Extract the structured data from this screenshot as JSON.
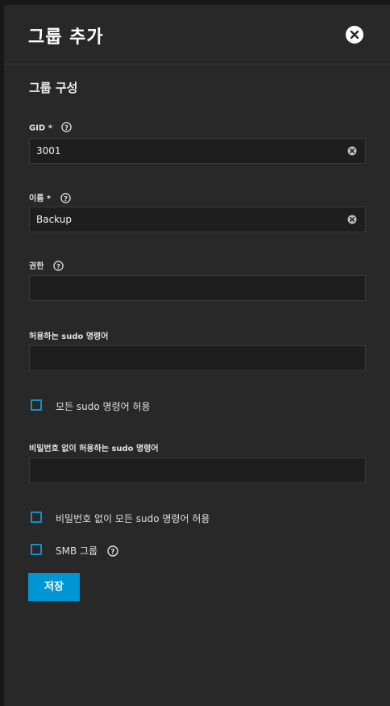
{
  "dialog": {
    "title": "그룹 추가",
    "close_icon": "close-circle-icon",
    "section_title": "그룹 구성"
  },
  "fields": {
    "gid": {
      "label": "GID *",
      "value": "3001"
    },
    "name": {
      "label": "이름 *",
      "value": "Backup"
    },
    "privileges": {
      "label": "권한",
      "value": ""
    },
    "sudo_commands": {
      "label": "허용하는 sudo 명령어",
      "value": ""
    },
    "sudo_commands_nopasswd": {
      "label": "비밀번호 없이 허용하는 sudo 명령어",
      "value": ""
    }
  },
  "checkboxes": {
    "allow_all_sudo": {
      "label": "모든 sudo 명령어 허용",
      "checked": false
    },
    "allow_all_sudo_nopasswd": {
      "label": "비밀번호 없이 모든 sudo 명령어 허용",
      "checked": false
    },
    "smb_group": {
      "label": "SMB 그룹",
      "checked": false
    }
  },
  "actions": {
    "save_label": "저장"
  },
  "colors": {
    "accent": "#0095d5",
    "checkbox_border": "#1a8cc4",
    "panel_bg": "#282828",
    "input_bg": "#1e1e1e"
  }
}
